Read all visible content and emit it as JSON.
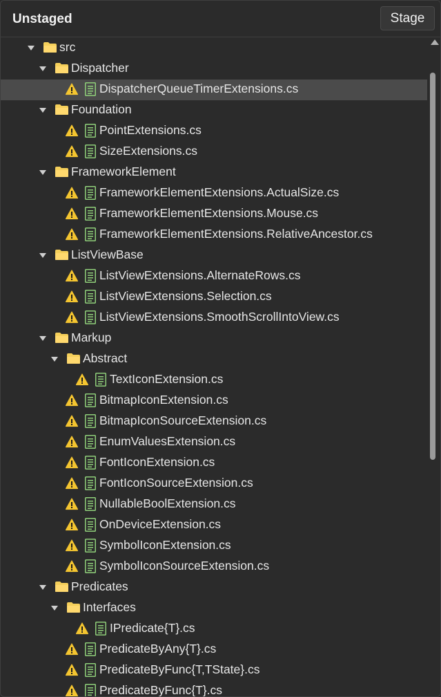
{
  "panel": {
    "title": "Unstaged",
    "stage_label": "Stage"
  },
  "icons": {
    "chevron": "chevron-down-icon",
    "folder": "folder-icon",
    "warning": "warning-icon",
    "file": "file-icon"
  },
  "colors": {
    "background": "#2b2b2b",
    "selected": "#4b4b4b",
    "folder": "#f5cf5a",
    "warning": "#f4c530",
    "file": "#8fcf7a"
  },
  "tree": [
    {
      "type": "folder",
      "name": "src",
      "level": 0
    },
    {
      "type": "folder",
      "name": "Dispatcher",
      "level": 1
    },
    {
      "type": "file",
      "name": "DispatcherQueueTimerExtensions.cs",
      "level": 2,
      "selected": true
    },
    {
      "type": "folder",
      "name": "Foundation",
      "level": 1
    },
    {
      "type": "file",
      "name": "PointExtensions.cs",
      "level": 2
    },
    {
      "type": "file",
      "name": "SizeExtensions.cs",
      "level": 2
    },
    {
      "type": "folder",
      "name": "FrameworkElement",
      "level": 1
    },
    {
      "type": "file",
      "name": "FrameworkElementExtensions.ActualSize.cs",
      "level": 2
    },
    {
      "type": "file",
      "name": "FrameworkElementExtensions.Mouse.cs",
      "level": 2
    },
    {
      "type": "file",
      "name": "FrameworkElementExtensions.RelativeAncestor.cs",
      "level": 2
    },
    {
      "type": "folder",
      "name": "ListViewBase",
      "level": 1
    },
    {
      "type": "file",
      "name": "ListViewExtensions.AlternateRows.cs",
      "level": 2
    },
    {
      "type": "file",
      "name": "ListViewExtensions.Selection.cs",
      "level": 2
    },
    {
      "type": "file",
      "name": "ListViewExtensions.SmoothScrollIntoView.cs",
      "level": 2
    },
    {
      "type": "folder",
      "name": "Markup",
      "level": 1
    },
    {
      "type": "folder",
      "name": "Abstract",
      "level": 2
    },
    {
      "type": "file",
      "name": "TextIconExtension.cs",
      "level": 3
    },
    {
      "type": "file",
      "name": "BitmapIconExtension.cs",
      "level": 2
    },
    {
      "type": "file",
      "name": "BitmapIconSourceExtension.cs",
      "level": 2
    },
    {
      "type": "file",
      "name": "EnumValuesExtension.cs",
      "level": 2
    },
    {
      "type": "file",
      "name": "FontIconExtension.cs",
      "level": 2
    },
    {
      "type": "file",
      "name": "FontIconSourceExtension.cs",
      "level": 2
    },
    {
      "type": "file",
      "name": "NullableBoolExtension.cs",
      "level": 2
    },
    {
      "type": "file",
      "name": "OnDeviceExtension.cs",
      "level": 2
    },
    {
      "type": "file",
      "name": "SymbolIconExtension.cs",
      "level": 2
    },
    {
      "type": "file",
      "name": "SymbolIconSourceExtension.cs",
      "level": 2
    },
    {
      "type": "folder",
      "name": "Predicates",
      "level": 1
    },
    {
      "type": "folder",
      "name": "Interfaces",
      "level": 2
    },
    {
      "type": "file",
      "name": "IPredicate{T}.cs",
      "level": 3
    },
    {
      "type": "file",
      "name": "PredicateByAny{T}.cs",
      "level": 2
    },
    {
      "type": "file",
      "name": "PredicateByFunc{T,TState}.cs",
      "level": 2
    },
    {
      "type": "file",
      "name": "PredicateByFunc{T}.cs",
      "level": 2
    }
  ]
}
